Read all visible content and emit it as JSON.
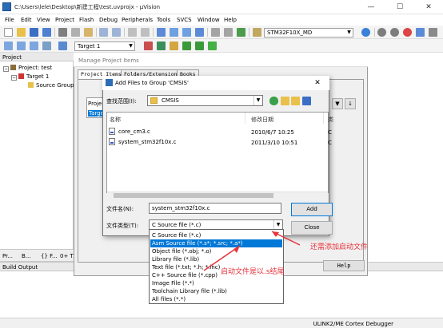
{
  "app": {
    "window_title": "C:\\Users\\lele\\Desktop\\新建工程\\test.uvprojx - µVision",
    "controls": [
      "—",
      "☐",
      "✕"
    ]
  },
  "menu": [
    "File",
    "Edit",
    "View",
    "Project",
    "Flash",
    "Debug",
    "Peripherals",
    "Tools",
    "SVCS",
    "Window",
    "Help"
  ],
  "toolbar": {
    "device_combo": "STM32F10X_MD",
    "target_combo": "Target 1"
  },
  "project_panel": {
    "title": "Project",
    "tree": [
      {
        "label": "Project: test"
      },
      {
        "label": "Target 1"
      },
      {
        "label": "Source Group"
      }
    ],
    "tabs": [
      "Pr...",
      "B...",
      "{} F...",
      "0+ T..."
    ]
  },
  "build_output": {
    "title": "Build Output"
  },
  "statusbar": {
    "debugger": "ULINK2/ME Cortex Debugger"
  },
  "manage_dialog": {
    "title": "Manage Project Items",
    "tabs": [
      "Project Items",
      "Folders/Extensions",
      "Books"
    ],
    "project_targets_label": "Proje",
    "target_item": "Targe",
    "help_button": "Help"
  },
  "add_files_dialog": {
    "title": "Add Files to Group 'CMSIS'",
    "look_in_label": "查找范围(I):",
    "look_in_value": "CMSIS",
    "columns": [
      "名称",
      "修改日期",
      "类"
    ],
    "files": [
      {
        "name": "core_cm3.c",
        "date": "2010/6/7 10:25",
        "type": "C"
      },
      {
        "name": "system_stm32f10x.c",
        "date": "2011/3/10 10:51",
        "type": "C"
      }
    ],
    "file_name_label": "文件名(N):",
    "file_name_value": "system_stm32f10x.c",
    "file_type_label": "文件类型(T):",
    "file_type_value": "C Source file (*.c)",
    "add_button": "Add",
    "close_button": "Close",
    "file_type_options": [
      "C Source file (*.c)",
      "Asm Source file (*.s*; *.src; *.a*)",
      "Object file (*.obj; *.o)",
      "Library file (*.lib)",
      "Text file (*.txt; *.h; *.inc)",
      "C++ Source file (*.cpp)",
      "Image File (*.*)",
      "Toolchain Library file (*.lib)",
      "All files (*.*)"
    ],
    "selected_option_index": 1
  },
  "annotations": {
    "note1": "还需添加启动文件",
    "note2": "启动文件是以.s结尾",
    "color": "#e5323b"
  }
}
